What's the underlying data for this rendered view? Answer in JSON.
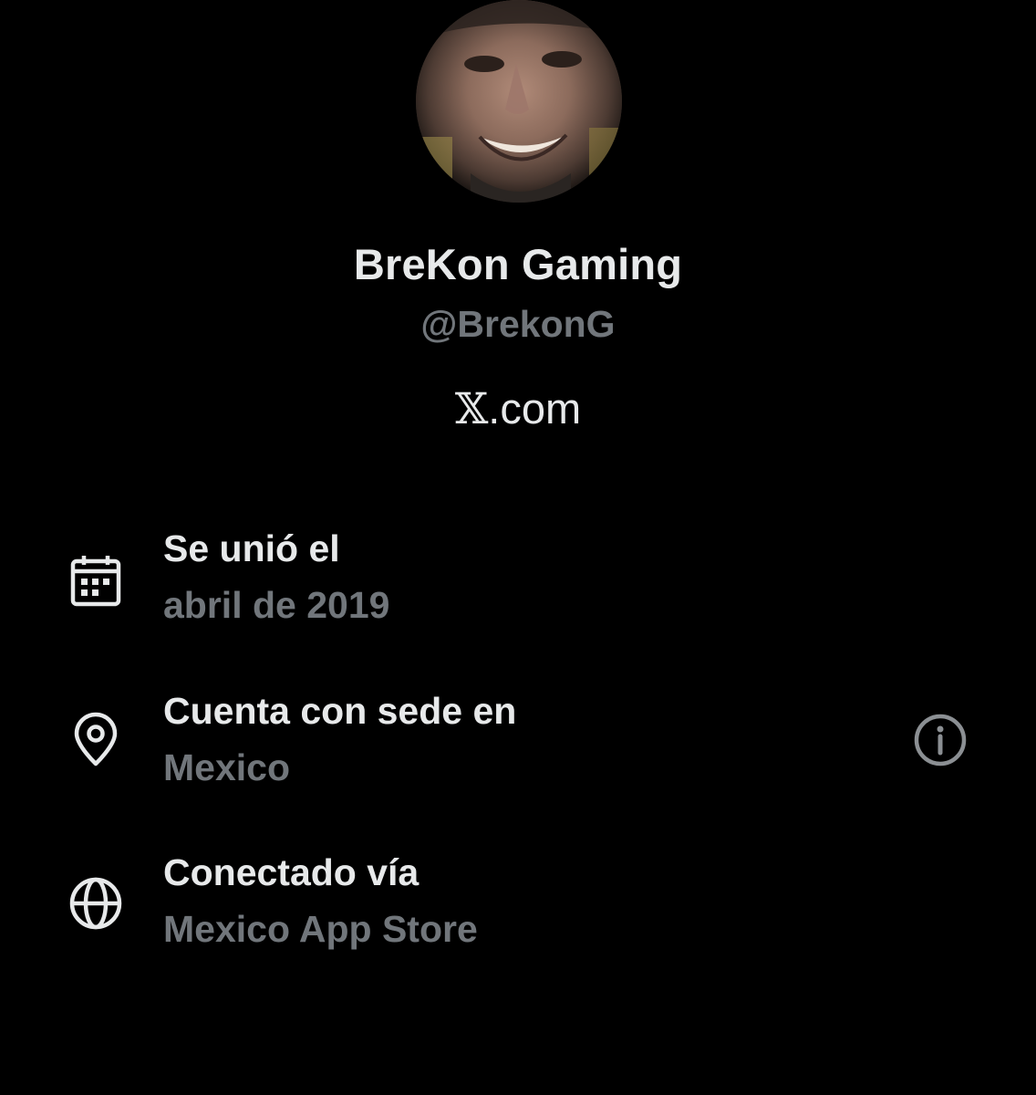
{
  "profile": {
    "display_name": "BreKon Gaming",
    "handle": "@BrekonG",
    "site_glyph": "𝕏",
    "site_suffix": ".com",
    "avatar_icon": "avatar-photo"
  },
  "about": [
    {
      "icon": "calendar-icon",
      "title": "Se unió el",
      "value": "abril de 2019"
    },
    {
      "icon": "location-pin-icon",
      "title": "Cuenta con sede en",
      "value": "Mexico",
      "action_icon": "info-icon"
    },
    {
      "icon": "globe-icon",
      "title": "Conectado vía",
      "value": "Mexico App Store"
    }
  ],
  "colors": {
    "background": "#000000",
    "primary_text": "#e7e9ea",
    "secondary_text": "#71767b",
    "icon": "#e7e9ea",
    "info_icon": "#8b8f93"
  }
}
